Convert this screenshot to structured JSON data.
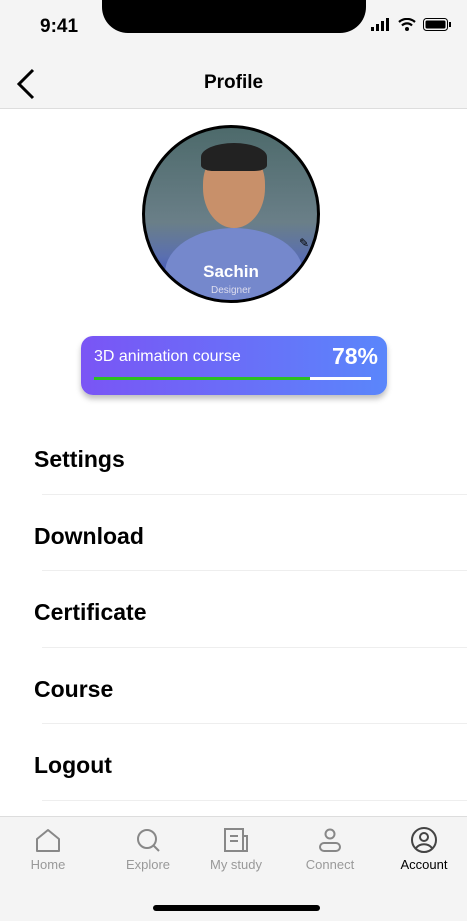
{
  "status": {
    "time": "9:41"
  },
  "header": {
    "title": "Profile"
  },
  "profile": {
    "name": "Sachin",
    "role": "Designer"
  },
  "course": {
    "name": "3D animation course",
    "percent_label": "78%",
    "progress": 0.78,
    "fill_color": "#2bc021"
  },
  "menu": {
    "items": [
      {
        "label": "Settings"
      },
      {
        "label": "Download"
      },
      {
        "label": "Certificate"
      },
      {
        "label": "Course"
      },
      {
        "label": "Logout"
      }
    ]
  },
  "tabs": [
    {
      "label": "Home",
      "icon": "home-icon"
    },
    {
      "label": "Explore",
      "icon": "search-icon"
    },
    {
      "label": "My study",
      "icon": "book-icon"
    },
    {
      "label": "Connect",
      "icon": "person-icon"
    },
    {
      "label": "Account",
      "icon": "account-icon",
      "active": true
    }
  ]
}
